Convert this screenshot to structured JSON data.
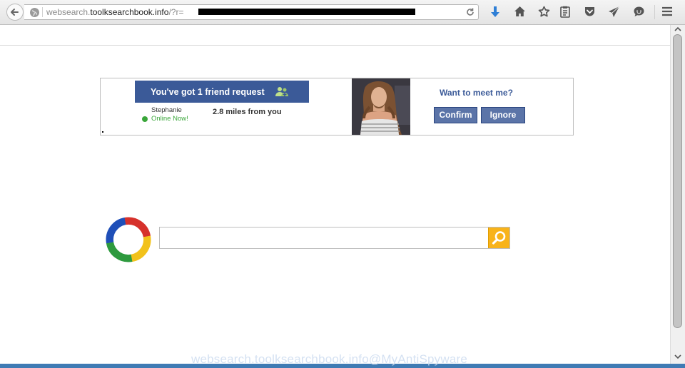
{
  "browser": {
    "url_host_prefix": "websearch.",
    "url_host": "toolksearchbook.info",
    "url_path": "/?r="
  },
  "ad": {
    "friend_request": "You've got 1 friend request",
    "name": "Stephanie",
    "status": "Online Now!",
    "distance": "2.8 miles from you",
    "prompt": "Want to meet me?",
    "confirm_label": "Confirm",
    "ignore_label": "Ignore"
  },
  "search": {
    "value": ""
  },
  "watermark": "websearch.toolksearchbook.info@MyAntiSpyware",
  "colors": {
    "facebook_blue": "#3b5a98",
    "button_blue": "#5b74a8",
    "search_button": "#f8b31a",
    "frame_blue": "#3f7bb4"
  }
}
